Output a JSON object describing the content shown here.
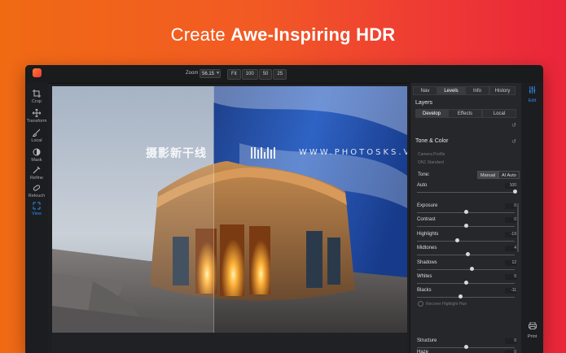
{
  "headline": {
    "part1": "Create ",
    "part2": "Awe-Inspiring HDR"
  },
  "titlebar": {
    "zoom_label": "Zoom",
    "zoom_value": "56.15",
    "zoom_buttons": [
      "Fit",
      "100",
      "50",
      "25"
    ]
  },
  "toolbar": {
    "items": [
      {
        "label": "Crop",
        "icon": "crop-icon"
      },
      {
        "label": "Transform",
        "icon": "transform-icon"
      },
      {
        "label": "Local",
        "icon": "brush-icon"
      },
      {
        "label": "Mask",
        "icon": "mask-icon"
      },
      {
        "label": "Refine",
        "icon": "refine-icon"
      },
      {
        "label": "Retouch",
        "icon": "retouch-icon"
      },
      {
        "label": "View",
        "icon": "view-icon"
      }
    ]
  },
  "photo": {
    "watermark_cn": "摄影新干线",
    "watermark_url": "WWW.PHOTOSKS.VIP"
  },
  "panel": {
    "tabs": [
      "Nav",
      "Levels",
      "Info",
      "History"
    ],
    "layers_title": "Layers",
    "sub_tabs": [
      "Develop",
      "Effects",
      "Local"
    ],
    "section_title": "Tone & Color",
    "camera_profile_label": "Camera Profile",
    "camera_profile_value": "ON1 Standard",
    "tone_label": "Tone:",
    "tone_buttons": [
      "Manual",
      "AI Auto"
    ],
    "checkbox_label": "Recover Highlight Hue",
    "sliders": [
      {
        "name": "Auto",
        "value": "100",
        "level": 1.0
      },
      {
        "name": "Exposure",
        "value": "0",
        "level": 0.5
      },
      {
        "name": "Contrast",
        "value": "0",
        "level": 0.5
      },
      {
        "name": "Highlights",
        "value": "-19",
        "level": 0.405
      },
      {
        "name": "Midtones",
        "value": "4",
        "level": 0.52
      },
      {
        "name": "Shadows",
        "value": "12",
        "level": 0.56
      },
      {
        "name": "Whites",
        "value": "0",
        "level": 0.5
      },
      {
        "name": "Blacks",
        "value": "-11",
        "level": 0.445
      },
      {
        "name": "Structure",
        "value": "0",
        "level": 0.5
      },
      {
        "name": "Haze",
        "value": "0",
        "level": 0.5
      }
    ]
  },
  "rightstrip": {
    "edit_label": "Edit",
    "print_label": "Print"
  },
  "colors": {
    "accent": "#2c8cf0",
    "bg_gradient_start": "#f06a14",
    "bg_gradient_end": "#e9253a"
  }
}
